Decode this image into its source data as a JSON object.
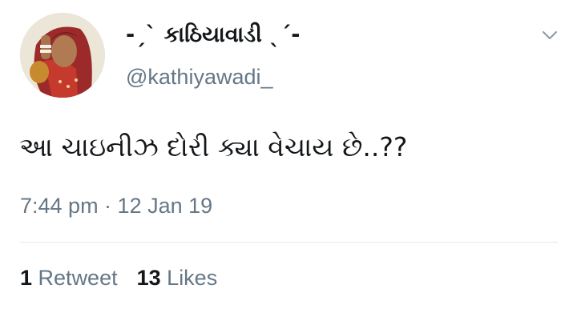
{
  "author": {
    "display_name": "-ˏˋ કાઠિયાવાડી ˎˊ-",
    "handle": "@kathiyawadi_"
  },
  "tweet": {
    "text": "આ ચાઇનીઝ દોરી ક્યા વેચાય છે..??",
    "timestamp": "7:44 pm · 12 Jan 19"
  },
  "stats": {
    "retweets_count": "1",
    "retweets_label": "Retweet",
    "likes_count": "13",
    "likes_label": "Likes"
  },
  "icons": {
    "menu": "chevron-down-icon",
    "avatar": "avatar"
  },
  "colors": {
    "text_primary": "#14171a",
    "text_secondary": "#657786",
    "divider": "#e1e8ed",
    "background": "#ffffff"
  }
}
